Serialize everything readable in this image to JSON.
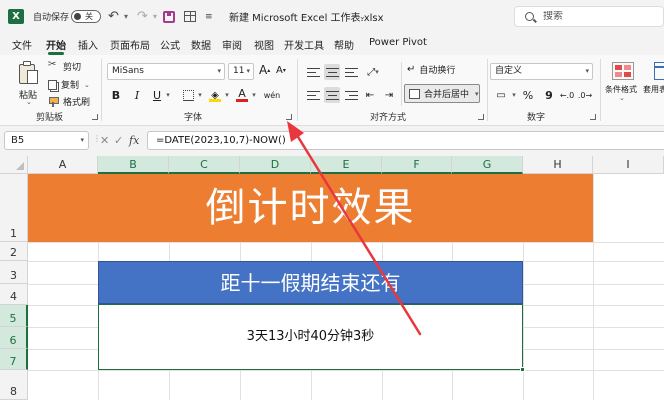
{
  "titlebar": {
    "app_logo": "X",
    "autosave_label": "自动保存",
    "autosave_state": "关",
    "document_title": "新建 Microsoft Excel 工作表.xlsx",
    "search_placeholder": "搜索"
  },
  "menu_tabs": [
    {
      "label": "文件"
    },
    {
      "label": "开始",
      "active": true
    },
    {
      "label": "插入"
    },
    {
      "label": "页面布局"
    },
    {
      "label": "公式"
    },
    {
      "label": "数据"
    },
    {
      "label": "审阅"
    },
    {
      "label": "视图"
    },
    {
      "label": "开发工具"
    },
    {
      "label": "帮助"
    },
    {
      "label": "Power Pivot"
    }
  ],
  "ribbon": {
    "clipboard": {
      "paste_label": "粘贴",
      "cut_label": "剪切",
      "copy_label": "复制",
      "format_painter_label": "格式刷",
      "group_label": "剪贴板"
    },
    "font": {
      "font_name": "MiSans",
      "font_size": "11",
      "grow_label": "A",
      "shrink_label": "A",
      "bold": "B",
      "italic": "I",
      "underline": "U",
      "font_color_label": "A",
      "phonetic_label": "wén",
      "group_label": "字体"
    },
    "alignment": {
      "wrap_label": "自动换行",
      "merge_label": "合并后居中",
      "group_label": "对齐方式"
    },
    "number": {
      "format": "自定义",
      "currency": "",
      "percent": "%",
      "comma": "9",
      "group_label": "数字"
    },
    "styles": {
      "conditional_formatting": "条件格式",
      "format_as_table": "套用表格格"
    }
  },
  "formula_bar": {
    "name_box": "B5",
    "cancel_symbol": "✕",
    "enter_symbol": "✓",
    "fx_symbol": "fx",
    "formula": "=DATE(2023,10,7)-NOW()"
  },
  "grid": {
    "columns": [
      "A",
      "B",
      "C",
      "D",
      "E",
      "F",
      "G",
      "H",
      "I"
    ],
    "selected_columns": [
      "B",
      "C",
      "D",
      "E",
      "F",
      "G"
    ],
    "rows": [
      "1",
      "2",
      "3",
      "4",
      "5",
      "6",
      "7",
      "8"
    ],
    "selected_rows": [
      "5",
      "6",
      "7"
    ],
    "banner_text": "倒计时效果",
    "subheading_text": "距十一假期结束还有",
    "countdown_text": "3天13小时40分钟3秒"
  },
  "colors": {
    "banner": "#ed7d31",
    "subheading": "#4472c4",
    "selection": "#1d6f42",
    "annotation_arrow": "#e8383d"
  }
}
